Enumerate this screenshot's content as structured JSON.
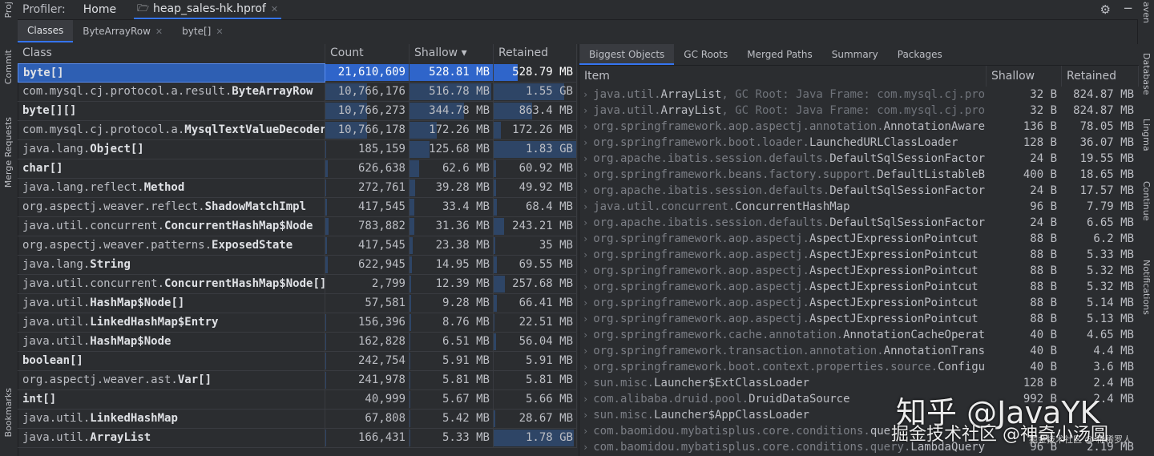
{
  "left_strip": {
    "project": "Proj",
    "commit": "Commit",
    "merge_requests": "Merge Requests",
    "bookmarks": "Bookmarks"
  },
  "right_strip": {
    "maven": "aven",
    "database": "Database",
    "lingma": "Lingma",
    "continue": "Continue",
    "notifications": "Notifications"
  },
  "topbar": {
    "label": "Profiler:",
    "home": "Home",
    "file_tab": "heap_sales-hk.hprof"
  },
  "subtabs": [
    "Classes",
    "ByteArrayRow",
    "byte[]"
  ],
  "left_table": {
    "headers": {
      "class": "Class",
      "count": "Count",
      "shallow": "Shallow ▾",
      "retained": "Retained"
    },
    "rows": [
      {
        "pkg": "",
        "name": "byte[]",
        "count": "21,610,609",
        "shallow": "528.81 MB",
        "retained": "528.79 MB",
        "count_f": 1.0,
        "shallow_f": 1.0,
        "retained_f": 0.29
      },
      {
        "pkg": "com.mysql.cj.protocol.a.result.",
        "name": "ByteArrayRow",
        "count": "10,766,176",
        "shallow": "516.78 MB",
        "retained": "1.55 GB",
        "count_f": 0.5,
        "shallow_f": 0.98,
        "retained_f": 0.85
      },
      {
        "pkg": "",
        "name": "byte[][]",
        "count": "10,766,273",
        "shallow": "344.78 MB",
        "retained": "863.4 MB",
        "count_f": 0.5,
        "shallow_f": 0.65,
        "retained_f": 0.47
      },
      {
        "pkg": "com.mysql.cj.protocol.a.",
        "name": "MysqlTextValueDecoder",
        "count": "10,766,178",
        "shallow": "172.26 MB",
        "retained": "172.26 MB",
        "count_f": 0.5,
        "shallow_f": 0.33,
        "retained_f": 0.09
      },
      {
        "pkg": "java.lang.",
        "name": "Object[]",
        "count": "185,159",
        "shallow": "125.68 MB",
        "retained": "1.83 GB",
        "count_f": 0.01,
        "shallow_f": 0.24,
        "retained_f": 1.0
      },
      {
        "pkg": "",
        "name": "char[]",
        "count": "626,638",
        "shallow": "62.6 MB",
        "retained": "60.92 MB",
        "count_f": 0.03,
        "shallow_f": 0.12,
        "retained_f": 0.03
      },
      {
        "pkg": "java.lang.reflect.",
        "name": "Method",
        "count": "272,761",
        "shallow": "39.28 MB",
        "retained": "49.92 MB",
        "count_f": 0.01,
        "shallow_f": 0.07,
        "retained_f": 0.03
      },
      {
        "pkg": "org.aspectj.weaver.reflect.",
        "name": "ShadowMatchImpl",
        "count": "417,545",
        "shallow": "33.4 MB",
        "retained": "68.4 MB",
        "count_f": 0.02,
        "shallow_f": 0.06,
        "retained_f": 0.04
      },
      {
        "pkg": "java.util.concurrent.",
        "name": "ConcurrentHashMap$Node",
        "count": "783,882",
        "shallow": "31.36 MB",
        "retained": "243.21 MB",
        "count_f": 0.04,
        "shallow_f": 0.06,
        "retained_f": 0.13
      },
      {
        "pkg": "org.aspectj.weaver.patterns.",
        "name": "ExposedState",
        "count": "417,545",
        "shallow": "23.38 MB",
        "retained": "35 MB",
        "count_f": 0.02,
        "shallow_f": 0.04,
        "retained_f": 0.02
      },
      {
        "pkg": "java.lang.",
        "name": "String",
        "count": "622,945",
        "shallow": "14.95 MB",
        "retained": "69.55 MB",
        "count_f": 0.03,
        "shallow_f": 0.03,
        "retained_f": 0.04
      },
      {
        "pkg": "java.util.concurrent.",
        "name": "ConcurrentHashMap$Node[]",
        "count": "2,799",
        "shallow": "12.39 MB",
        "retained": "257.68 MB",
        "count_f": 0.0,
        "shallow_f": 0.02,
        "retained_f": 0.14
      },
      {
        "pkg": "java.util.",
        "name": "HashMap$Node[]",
        "count": "57,581",
        "shallow": "9.28 MB",
        "retained": "66.41 MB",
        "count_f": 0.0,
        "shallow_f": 0.02,
        "retained_f": 0.04
      },
      {
        "pkg": "java.util.",
        "name": "LinkedHashMap$Entry",
        "count": "156,396",
        "shallow": "8.76 MB",
        "retained": "22.51 MB",
        "count_f": 0.01,
        "shallow_f": 0.02,
        "retained_f": 0.01
      },
      {
        "pkg": "java.util.",
        "name": "HashMap$Node",
        "count": "162,828",
        "shallow": "6.51 MB",
        "retained": "56.04 MB",
        "count_f": 0.01,
        "shallow_f": 0.01,
        "retained_f": 0.03
      },
      {
        "pkg": "",
        "name": "boolean[]",
        "count": "242,754",
        "shallow": "5.91 MB",
        "retained": "5.91 MB",
        "count_f": 0.01,
        "shallow_f": 0.01,
        "retained_f": 0.0
      },
      {
        "pkg": "org.aspectj.weaver.ast.",
        "name": "Var[]",
        "count": "241,978",
        "shallow": "5.81 MB",
        "retained": "5.81 MB",
        "count_f": 0.01,
        "shallow_f": 0.01,
        "retained_f": 0.0
      },
      {
        "pkg": "",
        "name": "int[]",
        "count": "40,999",
        "shallow": "5.67 MB",
        "retained": "5.66 MB",
        "count_f": 0.0,
        "shallow_f": 0.01,
        "retained_f": 0.0
      },
      {
        "pkg": "java.util.",
        "name": "LinkedHashMap",
        "count": "67,808",
        "shallow": "5.42 MB",
        "retained": "28.67 MB",
        "count_f": 0.0,
        "shallow_f": 0.01,
        "retained_f": 0.02
      },
      {
        "pkg": "java.util.",
        "name": "ArrayList",
        "count": "166,431",
        "shallow": "5.33 MB",
        "retained": "1.78 GB",
        "count_f": 0.01,
        "shallow_f": 0.01,
        "retained_f": 0.97
      }
    ]
  },
  "right_panel": {
    "tabs": [
      "Biggest Objects",
      "GC Roots",
      "Merged Paths",
      "Summary",
      "Packages"
    ],
    "headers": {
      "item": "Item",
      "shallow": "Shallow",
      "retained": "Retained"
    },
    "rows": [
      {
        "pkg": "java.util.",
        "cls": "ArrayList",
        "tail": ", GC Root: Java Frame: com.mysql.cj.pro",
        "shallow": "32 B",
        "retained": "824.87 MB"
      },
      {
        "pkg": "java.util.",
        "cls": "ArrayList",
        "tail": ", GC Root: Java Frame: com.mysql.cj.pro",
        "shallow": "32 B",
        "retained": "824.87 MB"
      },
      {
        "pkg": "org.springframework.aop.aspectj.annotation.",
        "cls": "AnnotationAware",
        "tail": "",
        "shallow": "136 B",
        "retained": "78.05 MB"
      },
      {
        "pkg": "org.springframework.boot.loader.",
        "cls": "LaunchedURLClassLoader",
        "tail": "",
        "shallow": "128 B",
        "retained": "36.07 MB"
      },
      {
        "pkg": "org.apache.ibatis.session.defaults.",
        "cls": "DefaultSqlSessionFactor",
        "tail": "",
        "shallow": "24 B",
        "retained": "19.55 MB"
      },
      {
        "pkg": "org.springframework.beans.factory.support.",
        "cls": "DefaultListableB",
        "tail": "",
        "shallow": "400 B",
        "retained": "18.65 MB"
      },
      {
        "pkg": "org.apache.ibatis.session.defaults.",
        "cls": "DefaultSqlSessionFactor",
        "tail": "",
        "shallow": "24 B",
        "retained": "17.57 MB"
      },
      {
        "pkg": "java.util.concurrent.",
        "cls": "ConcurrentHashMap",
        "tail": "",
        "shallow": "96 B",
        "retained": "7.79 MB"
      },
      {
        "pkg": "org.apache.ibatis.session.defaults.",
        "cls": "DefaultSqlSessionFactor",
        "tail": "",
        "shallow": "24 B",
        "retained": "6.65 MB"
      },
      {
        "pkg": "org.springframework.aop.aspectj.",
        "cls": "AspectJExpressionPointcut",
        "tail": "",
        "shallow": "88 B",
        "retained": "6.2 MB"
      },
      {
        "pkg": "org.springframework.aop.aspectj.",
        "cls": "AspectJExpressionPointcut",
        "tail": "",
        "shallow": "88 B",
        "retained": "5.33 MB"
      },
      {
        "pkg": "org.springframework.aop.aspectj.",
        "cls": "AspectJExpressionPointcut",
        "tail": "",
        "shallow": "88 B",
        "retained": "5.32 MB"
      },
      {
        "pkg": "org.springframework.aop.aspectj.",
        "cls": "AspectJExpressionPointcut",
        "tail": "",
        "shallow": "88 B",
        "retained": "5.32 MB"
      },
      {
        "pkg": "org.springframework.aop.aspectj.",
        "cls": "AspectJExpressionPointcut",
        "tail": "",
        "shallow": "88 B",
        "retained": "5.14 MB"
      },
      {
        "pkg": "org.springframework.aop.aspectj.",
        "cls": "AspectJExpressionPointcut",
        "tail": "",
        "shallow": "88 B",
        "retained": "5.13 MB"
      },
      {
        "pkg": "org.springframework.cache.annotation.",
        "cls": "AnnotationCacheOperat",
        "tail": "",
        "shallow": "40 B",
        "retained": "4.65 MB"
      },
      {
        "pkg": "org.springframework.transaction.annotation.",
        "cls": "AnnotationTrans",
        "tail": "",
        "shallow": "40 B",
        "retained": "4.4 MB"
      },
      {
        "pkg": "org.springframework.boot.context.properties.source.",
        "cls": "Configu",
        "tail": "",
        "shallow": "40 B",
        "retained": "3.6 MB"
      },
      {
        "pkg": "sun.misc.",
        "cls": "Launcher$ExtClassLoader",
        "tail": "",
        "shallow": "128 B",
        "retained": "2.4 MB"
      },
      {
        "pkg": "com.alibaba.druid.pool.",
        "cls": "DruidDataSource",
        "tail": "",
        "shallow": "992 B",
        "retained": "2.4 MB"
      },
      {
        "pkg": "sun.misc.",
        "cls": "Launcher$AppClassLoader",
        "tail": "",
        "shallow": "",
        "retained": ""
      },
      {
        "pkg": "com.baomidou.mybatisplus.core.conditions.",
        "cls": "que",
        "tail": "",
        "shallow": "",
        "retained": ""
      },
      {
        "pkg": "com.baomidou.mybatisplus.core.conditions.query.",
        "cls": "LambdaQuery",
        "tail": "",
        "shallow": "96 B",
        "retained": "2.19 MB"
      }
    ]
  },
  "watermark": {
    "line1": "知乎 @JavaYK",
    "line2": "掘金技术社区 @神奇小汤圆",
    "line3": "掘金技术社区 @ 稀稀罗人"
  },
  "colors": {
    "bg": "#2b2d30",
    "selection": "#2e5fb3",
    "bar": "#2e4566",
    "accent": "#3574f0"
  }
}
